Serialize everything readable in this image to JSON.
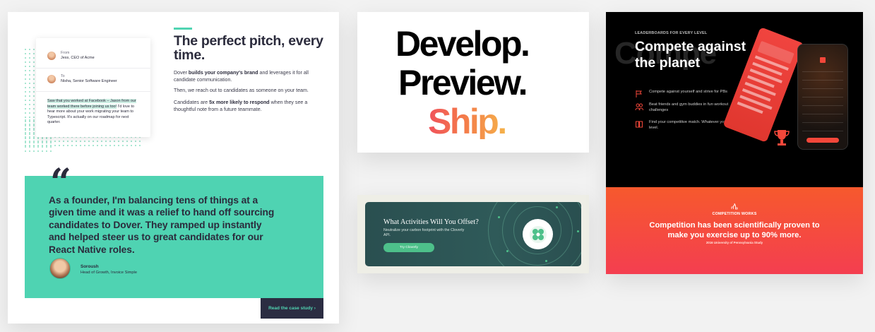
{
  "dover": {
    "email": {
      "from_label": "From",
      "from_name": "Jess, CEO of Acme",
      "to_label": "To",
      "to_name": "Nisha, Senior Software Engineer",
      "body_highlight": "Saw that you worked at Facebook – Jason from our team worked there before joining us too!",
      "body_rest": " I'd love to hear more about your work migrating your team to Typescript. It's actually on our roadmap for next quarter."
    },
    "title": "The perfect pitch, every time.",
    "p1_pre": "Dover ",
    "p1_bold": "builds your company's brand",
    "p1_post": " and leverages it for all candidate communication.",
    "p2": "Then, we reach out to candidates as someone on your team.",
    "p3_pre": "Candidates are ",
    "p3_bold": "5x more likely to respond",
    "p3_post": " when they see a thoughtful note from a future teammate.",
    "quote_mark": "“",
    "quote": "As a founder, I'm balancing tens of things at a given time and it was a relief to hand off sourcing candidates to Dover. They ramped up instantly and helped steer us to great candidates for our React Native roles.",
    "person_name": "Soroush",
    "person_role": "Head of Growth, Invoice Simple",
    "case_study": "Read the case study ›",
    "accent": "#4fd3b2"
  },
  "vercel": {
    "line1": "Develop.",
    "line2": "Preview.",
    "line3": "Ship."
  },
  "cloverly": {
    "title": "What Activities Will You Offset?",
    "subtitle": "Neutralize your carbon footprint with the Cloverly API.",
    "button": "Try Cloverly",
    "accent": "#4dc08a"
  },
  "competition": {
    "ghost": "Compe",
    "label": "LEADERBOARDS FOR EVERY LEVEL",
    "title": "Compete against the planet",
    "features": [
      "Compete against yourself and strive for PBs",
      "Beat friends and gym buddies in fun workout challenges",
      "Find your competitive match. Whatever your level."
    ],
    "bottom_label": "COMPETITION WORKS",
    "bottom_title": "Competition has been scientifically proven to make you exercise up to 90% more.",
    "bottom_source": "2016 University of Pennsylvania Study",
    "accent": "#f43e50"
  }
}
